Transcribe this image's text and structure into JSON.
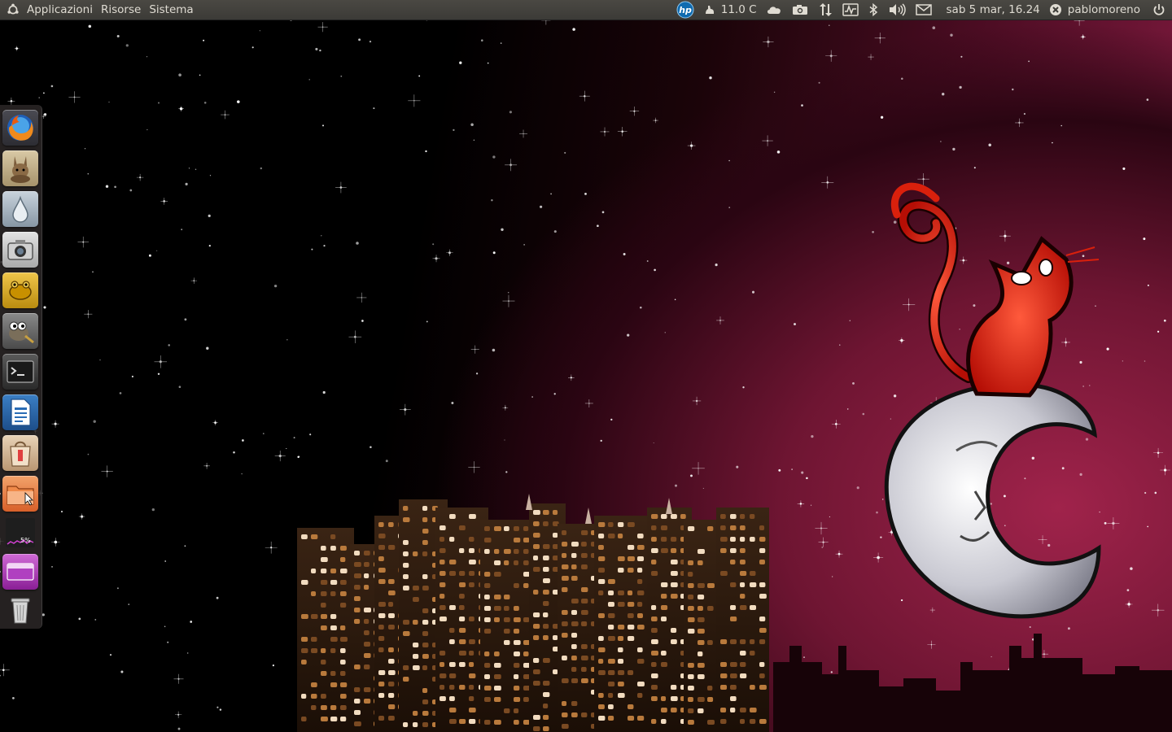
{
  "top_panel": {
    "menus": [
      {
        "label": "Applicazioni"
      },
      {
        "label": "Risorse"
      },
      {
        "label": "Sistema"
      }
    ],
    "weather_temp": "11.0 C",
    "datetime": "sab  5 mar, 16.24",
    "username": "pablomoreno",
    "indicators": [
      "hp-icon",
      "weather-icon",
      "cloud-icon",
      "camera-icon",
      "network-icon",
      "system-monitor-icon",
      "bluetooth-icon",
      "volume-icon",
      "mail-icon",
      "user-status-icon",
      "power-icon"
    ]
  },
  "launcher": {
    "items": [
      {
        "name": "firefox",
        "icon": "firefox-icon"
      },
      {
        "name": "aMule",
        "icon": "amule-icon"
      },
      {
        "name": "Drop",
        "icon": "drop-icon"
      },
      {
        "name": "Screenshot",
        "icon": "camera-icon"
      },
      {
        "name": "Frog",
        "icon": "frog-icon"
      },
      {
        "name": "GIMP",
        "icon": "gimp-icon"
      },
      {
        "name": "Terminal",
        "icon": "terminal-icon"
      },
      {
        "name": "Writer",
        "icon": "writer-icon"
      },
      {
        "name": "Software Center",
        "icon": "software-center-icon"
      },
      {
        "name": "Files",
        "icon": "folder-icon"
      },
      {
        "name": "System Monitor",
        "icon": "cpu-monitor-icon"
      },
      {
        "name": "Media",
        "icon": "media-icon"
      },
      {
        "name": "Trash",
        "icon": "trash-icon"
      }
    ],
    "cpu_percent_text": "5%"
  },
  "colors": {
    "panel": "#3c3b37",
    "panel_text": "#dfdbd2",
    "wallpaper_red": "#a0234b"
  }
}
